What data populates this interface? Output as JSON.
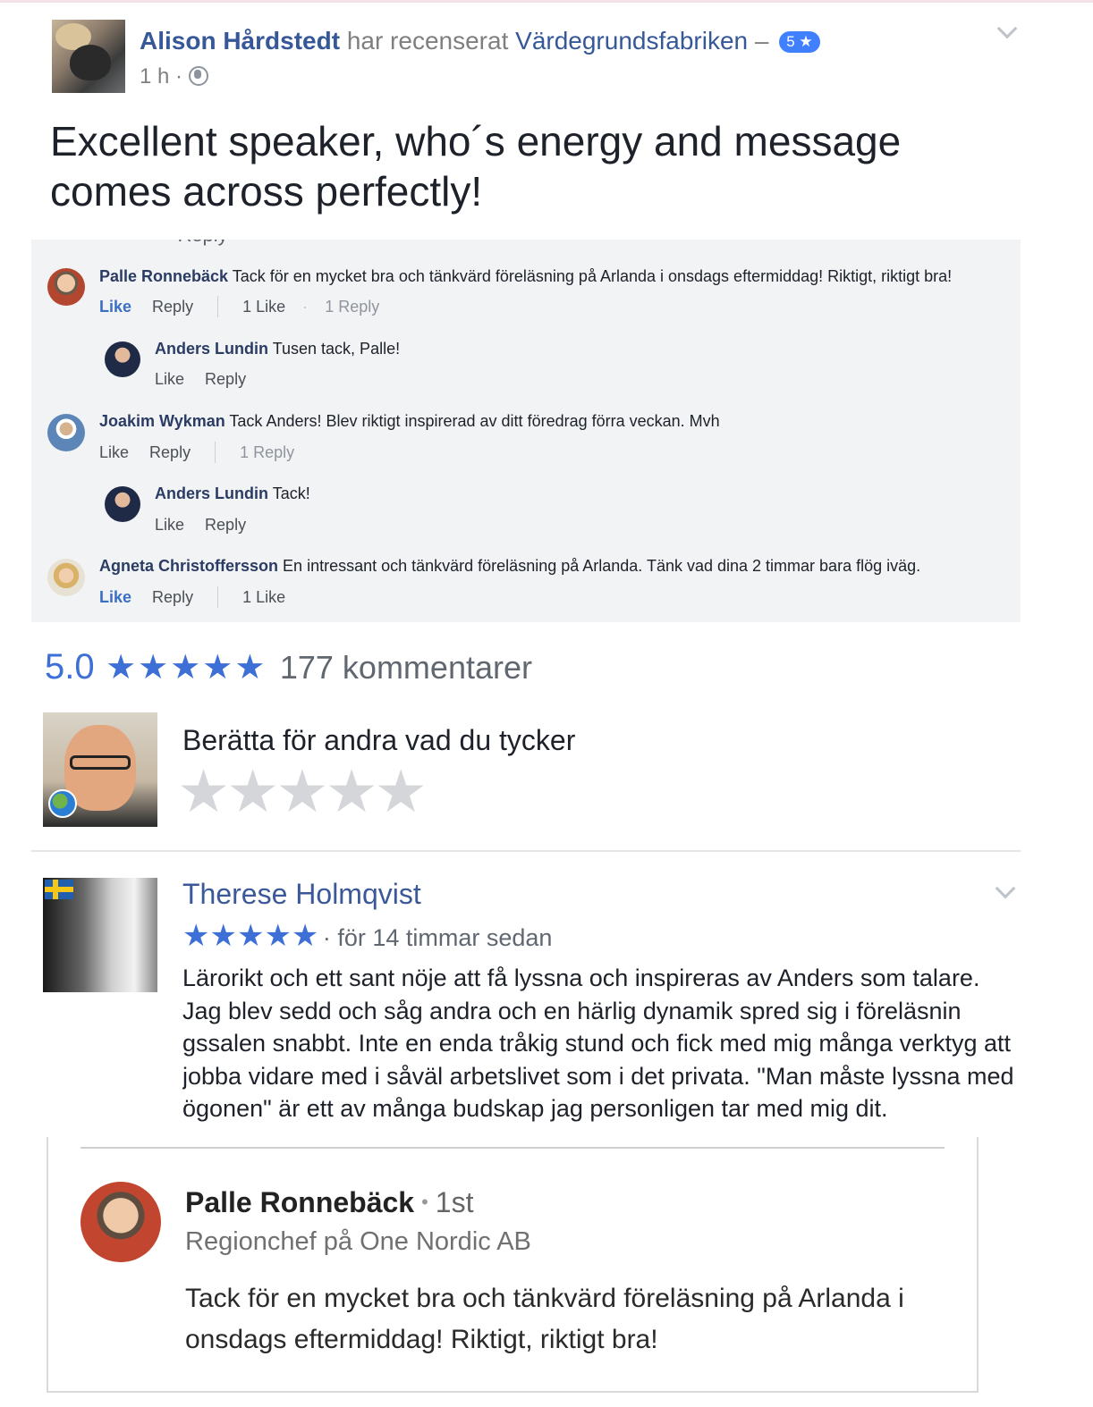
{
  "top_review": {
    "author": "Alison Hårdstedt",
    "verb": "har recenserat",
    "page_name": "Värdegrundsfabriken",
    "dash": "–",
    "badge": "5 ★",
    "time": "1 h ·",
    "text": "Excellent speaker, who´s energy and message comes across perfectly!"
  },
  "comments_cutoff_text": "· Reply",
  "comments": [
    {
      "author": "Palle Ronnebäck",
      "text": "Tack för en mycket bra och tänkvärd föreläsning på Arlanda i onsdags eftermiddag! Riktigt, riktigt bra!",
      "like": "Like",
      "reply": "Reply",
      "likes_count": "1 Like",
      "dot": "·",
      "replies_count": "1 Reply"
    },
    {
      "author": "Anders Lundin",
      "text": "Tusen tack, Palle!",
      "like": "Like",
      "reply": "Reply"
    },
    {
      "author": "Joakim Wykman",
      "text": "Tack Anders! Blev riktigt inspirerad av ditt föredrag förra veckan. Mvh",
      "like": "Like",
      "reply": "Reply",
      "replies_count": "1 Reply"
    },
    {
      "author": "Anders Lundin",
      "text": "Tack!",
      "like": "Like",
      "reply": "Reply"
    },
    {
      "author": "Agneta Christoffersson",
      "text": "En intressant och tänkvärd föreläsning på Arlanda. Tänk vad dina 2 timmar bara flög iväg.",
      "like": "Like",
      "reply": "Reply",
      "likes_count": "1 Like"
    }
  ],
  "rating_summary": {
    "score": "5.0",
    "stars": "★★★★★",
    "stars_value": 5,
    "count_label": "177 kommentarer"
  },
  "write_review": {
    "prompt": "Berätta för andra vad du tycker",
    "empty_stars": "★★★★★"
  },
  "second_review": {
    "author": "Therese Holmqvist",
    "stars": "★★★★★",
    "stars_value": 5,
    "time": " · för 14 timmar sedan",
    "text": "Lärorikt och ett sant nöje att få lyssna och inspireras av Anders som talare. Jag blev sedd och såg andra och en härlig dynamik spred sig i föreläsnin gssalen snabbt. Inte en enda tråkig stund och fick med mig många verktyg att jobba vidare med i såväl arbetslivet som i det privata. \"Man måste lyssna med ögonen\" är ett av många budskap jag personligen tar med mig dit."
  },
  "linkedin_card": {
    "author": "Palle Ronnebäck",
    "bullet": "•",
    "degree": "1st",
    "title": "Regionchef på One Nordic AB",
    "text": "Tack för en mycket bra och tänkvärd föreläsning på Arlanda i onsdags eftermiddag! Riktigt, riktigt bra!"
  },
  "colors": {
    "link_blue": "#365899",
    "star_blue": "#3e6fd6",
    "panel_bg": "#f2f3f5",
    "empty_star": "#d4d6da"
  }
}
